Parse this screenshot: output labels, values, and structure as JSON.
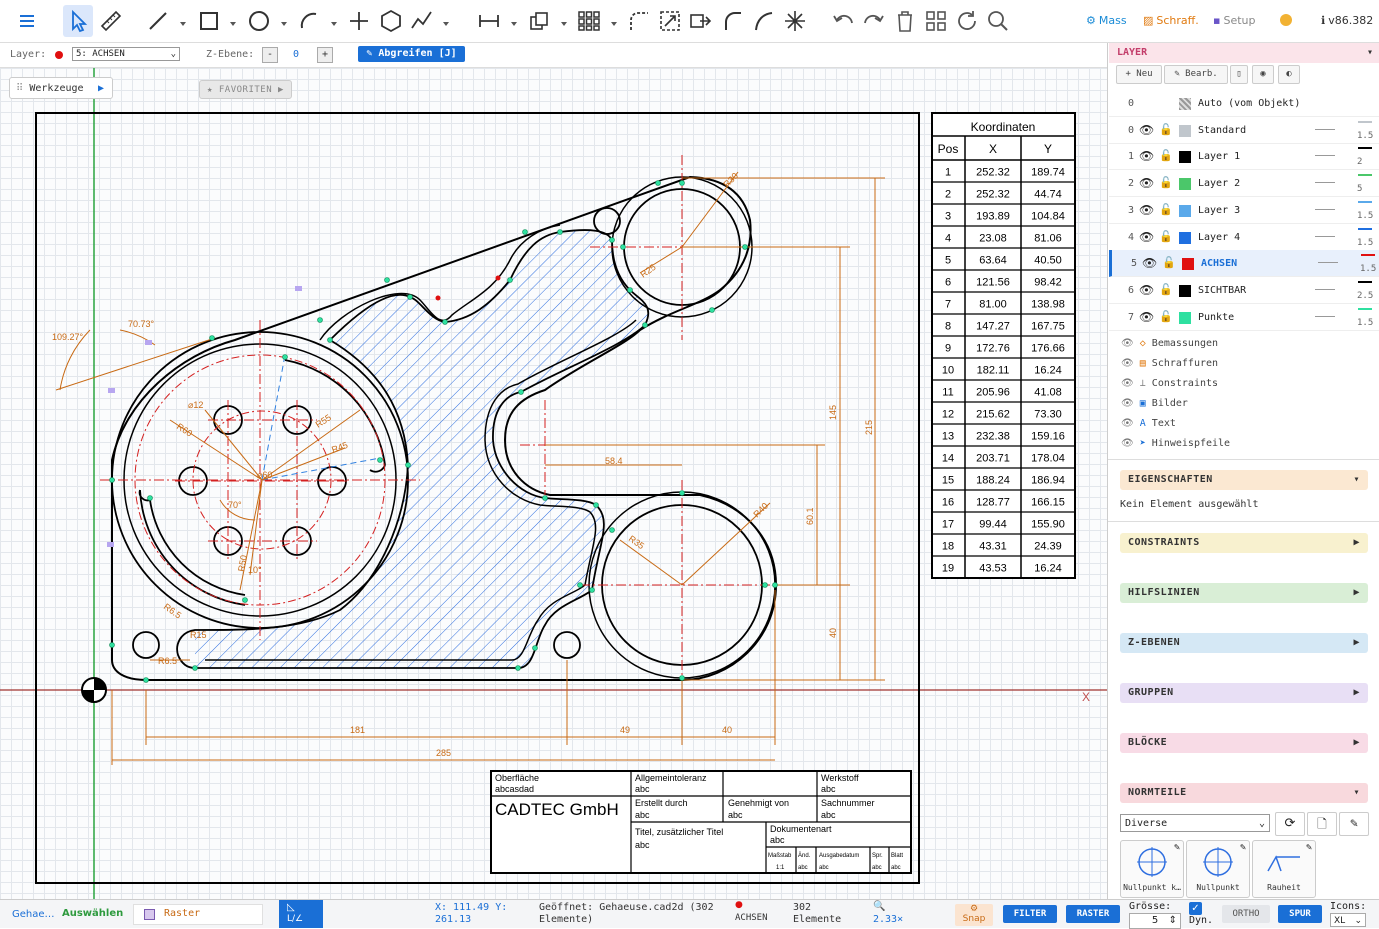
{
  "toolbar": {
    "menu_icon": "hamburger-icon",
    "tools": [
      "select-icon",
      "measure-icon",
      "line-icon",
      "rectangle-icon",
      "circle-icon",
      "arc-icon",
      "point-icon",
      "polygon-icon",
      "polyline-icon",
      "dimension-icon",
      "copy-icon",
      "array-icon",
      "fillet-icon",
      "scale-icon",
      "move-icon",
      "arc-tool-icon",
      "curve-icon",
      "explode-icon",
      "undo-icon",
      "redo-icon",
      "delete-icon",
      "grid-icon",
      "refresh-icon",
      "search-icon"
    ],
    "mass_label": "Mass",
    "schraff_label": "Schraff.",
    "setup_label": "Setup",
    "version": "v86.382"
  },
  "bar2": {
    "layer_label": "Layer:",
    "layer_value": "5: ACHSEN",
    "zebene_label": "Z-Ebene:",
    "zebene_value": "0",
    "minus": "-",
    "plus": "+",
    "grab_label": "Abgreifen [J]"
  },
  "canvas": {
    "werkzeuge_label": "Werkzeuge",
    "favoriten_label": "FAVORITEN",
    "axis_x_label": "X"
  },
  "coord_table": {
    "title": "Koordinaten",
    "headers": [
      "Pos",
      "X",
      "Y"
    ],
    "rows": [
      [
        "1",
        "252.32",
        "189.74"
      ],
      [
        "2",
        "252.32",
        "44.74"
      ],
      [
        "3",
        "193.89",
        "104.84"
      ],
      [
        "4",
        "23.08",
        "81.06"
      ],
      [
        "5",
        "63.64",
        "40.50"
      ],
      [
        "6",
        "121.56",
        "98.42"
      ],
      [
        "7",
        "81.00",
        "138.98"
      ],
      [
        "8",
        "147.27",
        "167.75"
      ],
      [
        "9",
        "172.76",
        "176.66"
      ],
      [
        "10",
        "182.11",
        "16.24"
      ],
      [
        "11",
        "205.96",
        "41.08"
      ],
      [
        "12",
        "215.62",
        "73.30"
      ],
      [
        "13",
        "232.38",
        "159.16"
      ],
      [
        "14",
        "203.71",
        "178.04"
      ],
      [
        "15",
        "188.24",
        "186.94"
      ],
      [
        "16",
        "128.77",
        "166.15"
      ],
      [
        "17",
        "99.44",
        "155.90"
      ],
      [
        "18",
        "43.31",
        "24.39"
      ],
      [
        "19",
        "43.53",
        "16.24"
      ]
    ]
  },
  "dimensions": {
    "d181": "181",
    "d49": "49",
    "d40h": "40",
    "d285": "285",
    "d584": "58.4",
    "d145": "145",
    "d215": "215",
    "d601": "60.1",
    "d40v": "40",
    "r30": "R30",
    "r25": "R25",
    "r40": "R40",
    "r35": "R35",
    "r60": "R60",
    "r55": "R55",
    "r45": "R45",
    "r50": "R50",
    "r65a": "R6.5",
    "r65b": "R6.5",
    "r15": "R15",
    "o12": "⌀12",
    "o60": "⌀60",
    "a70": "70°",
    "a10": "10°",
    "a7073": "70.73°",
    "a10927": "109.27°"
  },
  "title_block": {
    "oberflaeche": "Oberfläche",
    "oberflaeche_v": "abcasdad",
    "allg": "Allgemeintoleranz",
    "allg_v": "abc",
    "werkstoff": "Werkstoff",
    "werkstoff_v": "abc",
    "company": "CADTEC GmbH",
    "erstellt": "Erstellt durch",
    "erstellt_v": "abc",
    "genehmigt": "Genehmigt von",
    "genehmigt_v": "abc",
    "sachnummer": "Sachnummer",
    "sachnummer_v": "abc",
    "titel": "Titel, zusätzlicher Titel",
    "titel_v": "abc",
    "dokart": "Dokumentenart",
    "dokart_v": "abc",
    "massstab": "Maßstab",
    "massstab_v": "1:1",
    "aend": "Änd.",
    "aend_v": "abc",
    "ausgabe": "Ausgabedatum",
    "ausgabe_v": "abc",
    "spr": "Spr.",
    "spr_v": "abc",
    "blatt": "Blatt",
    "blatt_v": "abc"
  },
  "panel": {
    "layer_title": "LAYER",
    "btn_new": "+ Neu",
    "btn_edit": "✎ Bearb.",
    "layers": [
      {
        "num": "0",
        "name": "Auto (vom Objekt)",
        "color": "#9a9a9a",
        "width": ""
      },
      {
        "num": "0",
        "name": "Standard",
        "color": "#c0c6cc",
        "width": "1.5"
      },
      {
        "num": "1",
        "name": "Layer 1",
        "color": "#000000",
        "width": "2"
      },
      {
        "num": "2",
        "name": "Layer 2",
        "color": "#4bc76a",
        "width": "5"
      },
      {
        "num": "3",
        "name": "Layer 3",
        "color": "#5aa9ea",
        "width": "1.5"
      },
      {
        "num": "4",
        "name": "Layer 4",
        "color": "#1f6fe0",
        "width": "1.5"
      },
      {
        "num": "5",
        "name": "ACHSEN",
        "color": "#e01010",
        "width": "1.5"
      },
      {
        "num": "6",
        "name": "SICHTBAR",
        "color": "#000000",
        "width": "2.5"
      },
      {
        "num": "7",
        "name": "Punkte",
        "color": "#2ee0a0",
        "width": "1.5"
      }
    ],
    "categories": [
      "Bemassungen",
      "Schraffuren",
      "Constraints",
      "Bilder",
      "Text",
      "Hinweispfeile"
    ],
    "eigenschaften_title": "EIGENSCHAFTEN",
    "eigenschaften_text": "Kein Element ausgewählt",
    "constraints_title": "CONSTRAINTS",
    "hilfslinien_title": "HILFSLINIEN",
    "zebenen_title": "Z-EBENEN",
    "gruppen_title": "GRUPPEN",
    "bloecke_title": "BLÖCKE",
    "normteile_title": "NORMTEILE",
    "normteile_select": "Diverse",
    "parts": [
      "Nullpunkt k…",
      "Nullpunkt",
      "Rauheit"
    ]
  },
  "status": {
    "file_short": "Gehae…",
    "mode": "Auswählen",
    "raster_label": "Raster",
    "lz_label": "L/∠",
    "coords": "X: 111.49 Y: 261.13",
    "opened": "Geöffnet: Gehaeuse.cad2d (302 Elemente)",
    "layer": "ACHSEN",
    "elements": "302 Elemente",
    "zoom": "2.33×",
    "snap": "Snap",
    "filter": "FILTER",
    "raster_btn": "RASTER",
    "groesse_label": "Grösse:",
    "groesse_value": "5",
    "dyn": "Dyn.",
    "ortho": "ORTHO",
    "spur": "SPUR",
    "icons_label": "Icons:",
    "icons_value": "XL"
  }
}
